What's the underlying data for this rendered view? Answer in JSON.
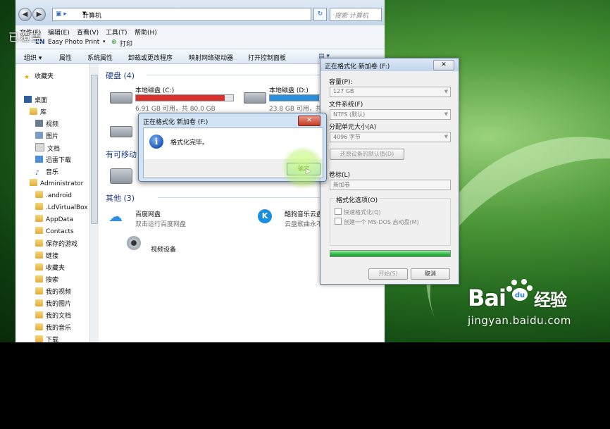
{
  "overlay_caption": "已覆盖",
  "explorer": {
    "address": "计算机",
    "search_placeholder": "搜索 计算机",
    "menu": [
      "文件(F)",
      "编辑(E)",
      "查看(V)",
      "工具(T)",
      "帮助(H)"
    ],
    "easybar": {
      "brand": "EN",
      "app": "Easy Photo Print",
      "print": "打印"
    },
    "commands": [
      "组织 ▾",
      "属性",
      "系统属性",
      "卸载或更改程序",
      "映射网络驱动器",
      "打开控制面板"
    ],
    "nav": [
      {
        "label": "收藏夹",
        "icon": "star-icon"
      },
      {
        "label": "桌面",
        "icon": "desktop-icon"
      },
      {
        "label": "库",
        "icon": "library-icon"
      },
      {
        "label": "视频",
        "icon": "video-icon"
      },
      {
        "label": "图片",
        "icon": "picture-icon"
      },
      {
        "label": "文档",
        "icon": "document-icon"
      },
      {
        "label": "迅雷下载",
        "icon": "download-icon"
      },
      {
        "label": "音乐",
        "icon": "music-icon"
      },
      {
        "label": "Administrator",
        "icon": "user-folder-icon"
      },
      {
        "label": ".android",
        "icon": "folder-icon"
      },
      {
        "label": ".LdVirtualBox",
        "icon": "folder-icon"
      },
      {
        "label": "AppData",
        "icon": "folder-icon"
      },
      {
        "label": "Contacts",
        "icon": "folder-icon"
      },
      {
        "label": "保存的游戏",
        "icon": "folder-icon"
      },
      {
        "label": "链接",
        "icon": "folder-icon"
      },
      {
        "label": "收藏夹",
        "icon": "folder-icon"
      },
      {
        "label": "搜索",
        "icon": "folder-icon"
      },
      {
        "label": "我的视频",
        "icon": "folder-icon"
      },
      {
        "label": "我的图片",
        "icon": "folder-icon"
      },
      {
        "label": "我的文档",
        "icon": "folder-icon"
      },
      {
        "label": "我的音乐",
        "icon": "folder-icon"
      },
      {
        "label": "下载",
        "icon": "folder-icon"
      }
    ],
    "groups": {
      "hdd": "硬盘 (4)",
      "removable": "有可移动",
      "other": "其他 (3)"
    },
    "drives": [
      {
        "name": "本地磁盘 (C:)",
        "free": "6.91 GB 可用，共 80.0 GB",
        "used_fraction": 0.914,
        "bar_color": "#d9302a"
      },
      {
        "name": "本地磁盘 (D:)",
        "free": "23.8 GB 可用，共 7",
        "used_fraction": 0.7,
        "bar_color": "#2b8ed8"
      }
    ],
    "others": [
      {
        "name": "百度网盘",
        "desc": "双击运行百度网盘",
        "icon": "baidu-netdisk-icon"
      },
      {
        "name": "酷狗音乐云盘",
        "desc": "云盘歌曲永不丢失",
        "icon": "kugou-icon"
      },
      {
        "name": "视频设备",
        "desc": "",
        "icon": "webcam-icon"
      }
    ]
  },
  "format_panel": {
    "title": "正在格式化 新加卷 (F:)",
    "close": "✕",
    "capacity_label": "容量(P):",
    "capacity_value": "127 GB",
    "fs_label": "文件系统(F)",
    "fs_value": "NTFS (默认)",
    "alloc_label": "分配单元大小(A)",
    "alloc_value": "4096 字节",
    "restore_btn": "还原设备的默认值(D)",
    "volume_label": "卷标(L)",
    "volume_value": "新加卷",
    "options_label": "格式化选项(O)",
    "quick_format": "快速格式化(Q)",
    "msdos_disk": "创建一个 MS-DOS 启动盘(M)",
    "progress": 1.0,
    "start_btn": "开始(S)",
    "close_btn": "取消"
  },
  "done_dialog": {
    "title": "正在格式化 新加卷 (F:)",
    "close": "✕",
    "message": "格式化完毕。",
    "ok": "确定"
  },
  "watermark": {
    "logo_left": "Bai",
    "logo_right": "经验",
    "url": "jingyan.baidu.com"
  }
}
